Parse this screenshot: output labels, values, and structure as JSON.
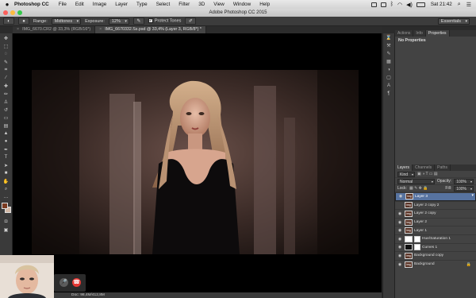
{
  "menubar": {
    "app_name": "Photoshop CC",
    "items": [
      "File",
      "Edit",
      "Image",
      "Layer",
      "Type",
      "Select",
      "Filter",
      "3D",
      "View",
      "Window",
      "Help"
    ],
    "clock": "Sat 21:42"
  },
  "window": {
    "title": "Adobe Photoshop CC 2015"
  },
  "options_bar": {
    "range_label": "Range:",
    "range_value": "Midtones",
    "exposure_label": "Exposure:",
    "exposure_value": "12%",
    "protect_tones_label": "Protect Tones",
    "workspace": "Essentials"
  },
  "doc_tabs": [
    {
      "label": "IMG_6670.CR2 @ 33,3% (RGB/16*)",
      "active": false
    },
    {
      "label": "IMG_6670332.Ss.psd @ 33,4% (Layer 3, RGB/8*) *",
      "active": true
    }
  ],
  "status": {
    "text": "Doc: 98,4M/412,8M"
  },
  "properties_panel": {
    "tabs": [
      "Actions",
      "Info",
      "Properties"
    ],
    "title": "No Properties"
  },
  "layers_panel": {
    "tabs": [
      "Layers",
      "Channels",
      "Paths"
    ],
    "filter_kind": "Kind",
    "blend_mode": "Normal",
    "opacity_label": "Opacity:",
    "opacity_value": "100%",
    "lock_label": "Lock:",
    "fill_label": "Fill:",
    "fill_value": "100%",
    "layers": [
      {
        "name": "Layer 3",
        "selected": true,
        "thumb": "photo",
        "eye": true
      },
      {
        "name": "Layer 2 copy 2",
        "selected": false,
        "thumb": "photo",
        "eye": false
      },
      {
        "name": "Layer 2 copy",
        "selected": false,
        "thumb": "photo",
        "eye": true
      },
      {
        "name": "Layer 2",
        "selected": false,
        "thumb": "photo",
        "eye": true
      },
      {
        "name": "Layer 1",
        "selected": false,
        "thumb": "photo",
        "eye": true
      },
      {
        "name": "Hue/Saturation 1",
        "selected": false,
        "thumb": "adjust",
        "eye": true
      },
      {
        "name": "Curves 1",
        "selected": false,
        "thumb": "curve",
        "eye": true
      },
      {
        "name": "Background copy",
        "selected": false,
        "thumb": "photo",
        "eye": true
      },
      {
        "name": "Background",
        "selected": false,
        "thumb": "photo",
        "eye": true,
        "locked": true
      }
    ]
  },
  "tools": [
    "move-icon",
    "marquee-icon",
    "lasso-icon",
    "quick-select-icon",
    "crop-icon",
    "eyedropper-icon",
    "healing-icon",
    "brush-icon",
    "clone-stamp-icon",
    "history-brush-icon",
    "eraser-icon",
    "gradient-icon",
    "blur-icon",
    "dodge-icon",
    "pen-icon",
    "type-icon",
    "path-select-icon",
    "shape-icon",
    "hand-icon",
    "zoom-icon"
  ],
  "colors": {
    "accent": "#5773a0",
    "panel": "#434343",
    "close": "#fc605c",
    "minimize": "#fdbc40",
    "maximize": "#34c84a"
  }
}
